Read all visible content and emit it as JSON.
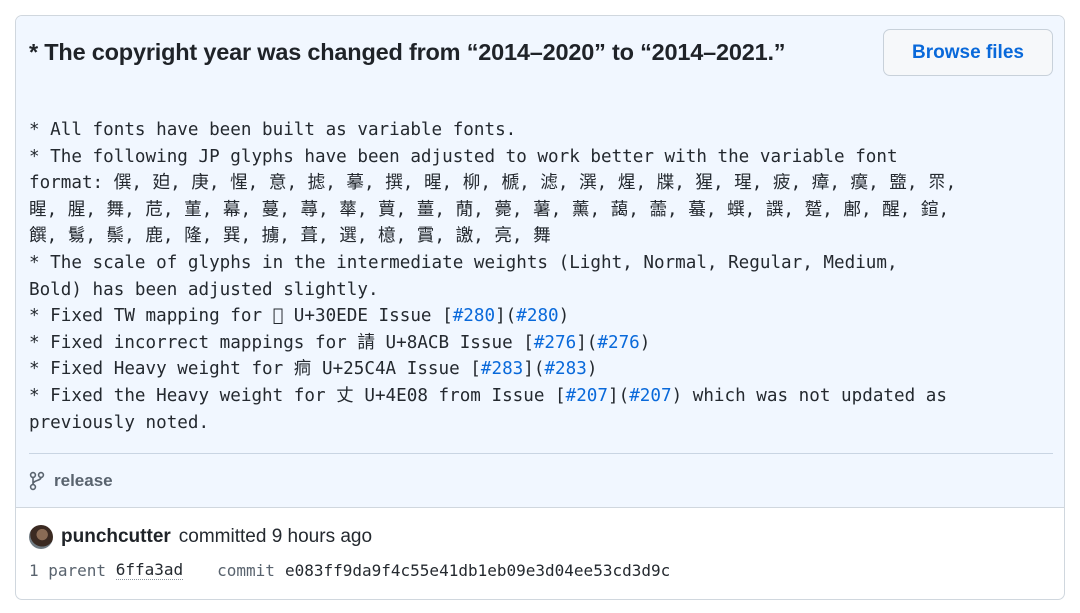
{
  "commit": {
    "title": "* The copyright year was changed from “2014–2020” to “2014–2021.”",
    "browse_label": "Browse files",
    "body_lines": [
      [
        {
          "t": "* All fonts have been built as variable fonts."
        }
      ],
      [
        {
          "t": "* The following JP glyphs have been adjusted to work better with the variable font"
        }
      ],
      [
        {
          "t": "format: 僎, 廹, 庚, 惺, 意, 摅, 摹, 撰, 暒, 柳, 榹, 滤, 潠, 煋, 牒, 猩, 瑆, 疲, 瘴, 瘼, 盬, 眔,"
        }
      ],
      [
        {
          "t": "睲, 腥, 舞, 苊, 菫, 幕, 蔓, 蕁, 蕐, 蕒, 薑, 蕑, 薨, 薯, 薰, 藹, 蘦, 蟇, 蟤, 譔, 蹵, 鄌, 醒, 鍹,"
        }
      ],
      [
        {
          "t": "饌, 鬄, 鬃, 鹿, 隆, 巽, 擄, 葺, 選, 檍, 霣, 譤, 亮, 舞"
        }
      ],
      [
        {
          "t": "* The scale of glyphs in the intermediate weights (Light, Normal, Regular, Medium,"
        }
      ],
      [
        {
          "t": "Bold) has been adjusted slightly."
        }
      ],
      [
        {
          "t": "* Fixed TW mapping for 𫟈 U+30EDE Issue ["
        },
        {
          "t": "#280",
          "link": true
        },
        {
          "t": "]("
        },
        {
          "t": "#280",
          "link": true
        },
        {
          "t": ")"
        }
      ],
      [
        {
          "t": "* Fixed incorrect mappings for 請 U+8ACB Issue ["
        },
        {
          "t": "#276",
          "link": true
        },
        {
          "t": "]("
        },
        {
          "t": "#276",
          "link": true
        },
        {
          "t": ")"
        }
      ],
      [
        {
          "t": "* Fixed Heavy weight for 痌 U+25C4A Issue ["
        },
        {
          "t": "#283",
          "link": true
        },
        {
          "t": "]("
        },
        {
          "t": "#283",
          "link": true
        },
        {
          "t": ")"
        }
      ],
      [
        {
          "t": "* Fixed the Heavy weight for 丈 U+4E08 from Issue ["
        },
        {
          "t": "#207",
          "link": true
        },
        {
          "t": "]("
        },
        {
          "t": "#207",
          "link": true
        },
        {
          "t": ") which was not updated as"
        }
      ],
      [
        {
          "t": "previously noted."
        }
      ]
    ],
    "branch_icon": "git-branch-icon",
    "branch": "release",
    "author": "punchcutter",
    "committed_text": "committed 9 hours ago",
    "parent_label": "1 parent",
    "parent_hash": "6ffa3ad",
    "commit_label": "commit",
    "commit_hash": "e083ff9da9f4c55e41db1eb09e3d04ee53cd3d9c"
  },
  "colors": {
    "header_bg": "#f1f7ff",
    "link": "#0969da",
    "border": "#d0d7de"
  }
}
